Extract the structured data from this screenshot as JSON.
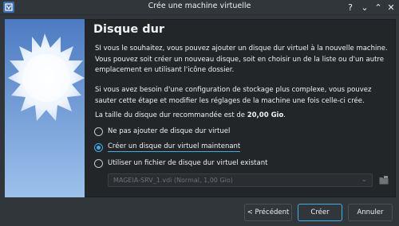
{
  "window": {
    "title": "Crée une machine virtuelle",
    "help_label": "?",
    "minimize_label": "⌄",
    "maximize_label": "⌃",
    "close_label": "✕"
  },
  "page": {
    "title": "Disque dur",
    "intro": "SI vous le souhaitez, vous pouvez ajouter un disque dur virtuel à la nouvelle machine. Vous pouvez soit créer un nouveau disque, soit en choisir un de la liste ou d'un autre emplacement en utilisant l'icône dossier.",
    "advanced": "Si vous avez besoin d'une configuration de stockage plus complexe, vous pouvez sauter cette étape et modifier les réglages de la machine une fois celle-ci crée.",
    "recommended_prefix": "La taille du disque dur recommandée est de ",
    "recommended_size": "20,00 Gio",
    "recommended_suffix": "."
  },
  "options": [
    {
      "label": "Ne pas ajouter de disque dur virtuel",
      "checked": false
    },
    {
      "label": "Créer un disque dur virtuel maintenant",
      "checked": true
    },
    {
      "label": "Utiliser un fichier de disque dur virtuel existant",
      "checked": false
    }
  ],
  "existing_disk": {
    "selected": "MAGEIA-SRV_1.vdi (Normal, 1,00 Gio)",
    "enabled": false
  },
  "buttons": {
    "back": "< Précédent",
    "create": "Créer",
    "cancel": "Annuler"
  },
  "colors": {
    "accent": "#3daee9",
    "window_bg": "#31363b",
    "content_bg": "#232629"
  }
}
